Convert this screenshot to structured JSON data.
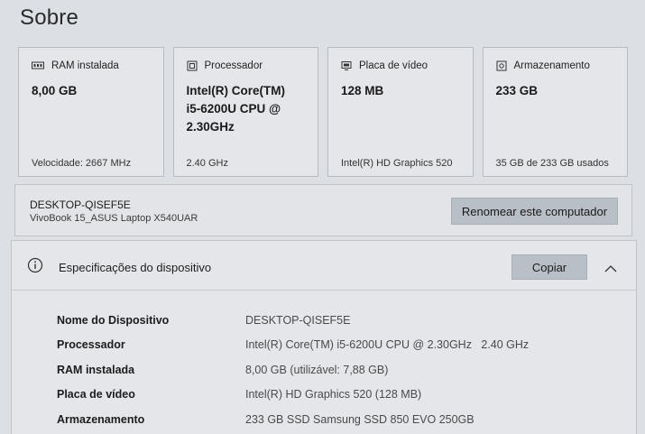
{
  "page": {
    "title": "Sobre"
  },
  "cards": [
    {
      "icon": "ram-icon",
      "label": "RAM instalada",
      "value": "8,00 GB",
      "footer": "Velocidade: 2667 MHz"
    },
    {
      "icon": "processor-icon",
      "label": "Processador",
      "value": "Intel(R) Core(TM)\ni5-6200U CPU @\n2.30GHz",
      "footer": "2.40 GHz"
    },
    {
      "icon": "display-icon",
      "label": "Placa de vídeo",
      "value": "128 MB",
      "footer": "Intel(R) HD Graphics 520"
    },
    {
      "icon": "storage-icon",
      "label": "Armazenamento",
      "value": "233 GB",
      "footer": "35 GB de 233 GB usados"
    }
  ],
  "computer": {
    "name": "DESKTOP-QISEF5E",
    "model": "VivoBook 15_ASUS Laptop X540UAR",
    "rename_label": "Renomear este computador"
  },
  "specs": {
    "icon": "info-icon",
    "title": "Especificações do dispositivo",
    "copy_label": "Copiar",
    "collapse_icon": "chevron-up-icon",
    "rows": [
      {
        "label": "Nome do Dispositivo",
        "value": "DESKTOP-QISEF5E"
      },
      {
        "label": "Processador",
        "value": "Intel(R) Core(TM) i5-6200U CPU @ 2.30GHz   2.40 GHz"
      },
      {
        "label": "RAM instalada",
        "value": "8,00 GB (utilizável: 7,88 GB)"
      },
      {
        "label": "Placa de vídeo",
        "value": "Intel(R) HD Graphics 520 (128 MB)"
      },
      {
        "label": "Armazenamento",
        "value": "233 GB SSD Samsung SSD 850 EVO 250GB"
      }
    ]
  },
  "colors": {
    "background": "#dcdfe3",
    "card_background": "#e4e6e9",
    "button_background": "#b9bfc7",
    "border": "#b8bcc2"
  }
}
